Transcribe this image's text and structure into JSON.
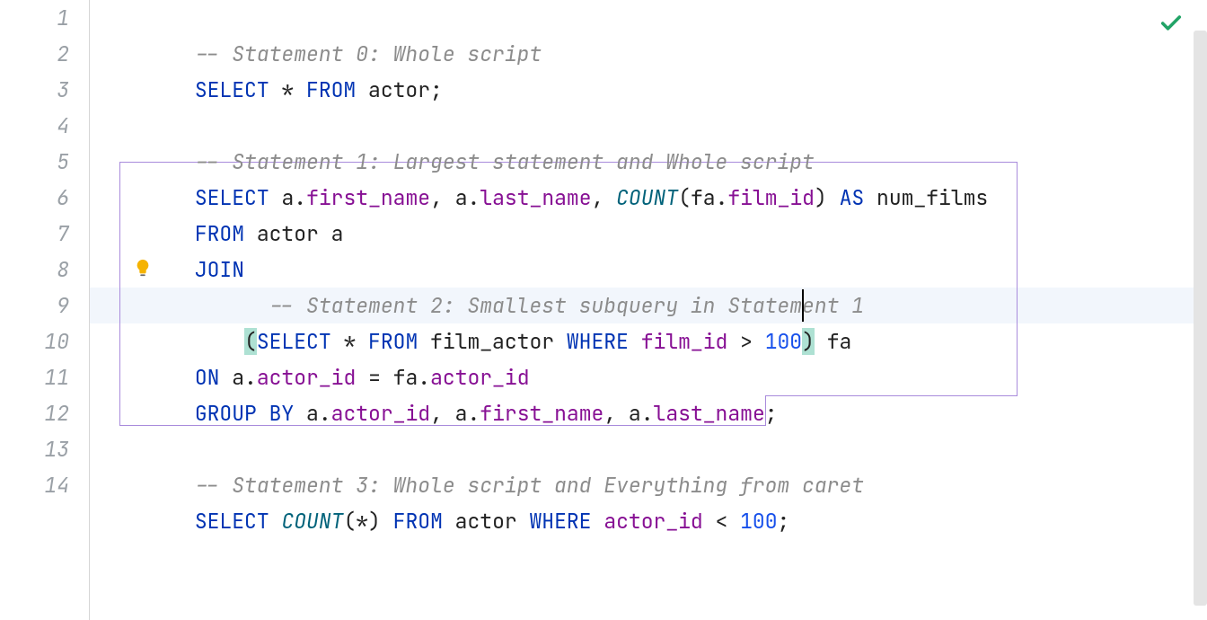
{
  "gutter": {
    "lines": [
      "1",
      "2",
      "3",
      "4",
      "5",
      "6",
      "7",
      "8",
      "9",
      "10",
      "11",
      "12",
      "13",
      "14"
    ]
  },
  "colors": {
    "keyword": "#0033b3",
    "identifier": "#871094",
    "function": "#00627a",
    "number": "#1750eb",
    "comment": "#8c8c8c",
    "text": "#222222",
    "bracket_highlight": "#aee1d3",
    "selection_border": "#a98cdc",
    "current_line_bg": "#f2f6fc"
  },
  "line1": {
    "comment": "-- Statement 0: Whole script"
  },
  "line2": {
    "select": "SELECT",
    "star": " * ",
    "from": "FROM",
    "actor": " actor",
    "semi": ";"
  },
  "line4": {
    "comment": "-- Statement 1: Largest statement and Whole script"
  },
  "line5": {
    "select": "SELECT",
    "sp1": " ",
    "a1": "a",
    "dot1": ".",
    "first": "first_name",
    "com1": ", ",
    "a2": "a",
    "dot2": ".",
    "last": "last_name",
    "com2": ", ",
    "count": "COUNT",
    "lp": "(",
    "fa": "fa",
    "dot3": ".",
    "film": "film_id",
    "rp": ")",
    "sp2": " ",
    "as": "AS",
    "sp3": " ",
    "num": "num_films"
  },
  "line6": {
    "from": "FROM",
    "rest": " actor a"
  },
  "line7": {
    "join": "JOIN"
  },
  "line8": {
    "indent": "      ",
    "comment": "-- Statement 2: Smallest subquery in Statement 1"
  },
  "line9": {
    "indent": "    ",
    "lp": "(",
    "select": "SELECT",
    "star": " * ",
    "from": "FROM",
    "fa": " film_actor ",
    "where": "WHERE",
    "sp1": " ",
    "film": "film_id",
    "gt": " > ",
    "hundred": "100",
    "rp": ")",
    "alias": " fa"
  },
  "line10": {
    "on": "ON",
    "sp1": " ",
    "a1": "a",
    "dot1": ".",
    "aid1": "actor_id",
    "eq": " = ",
    "fa": "fa",
    "dot2": ".",
    "aid2": "actor_id"
  },
  "line11": {
    "group": "GROUP BY",
    "sp1": " ",
    "a1": "a",
    "dot1": ".",
    "aid": "actor_id",
    "com1": ", ",
    "a2": "a",
    "dot2": ".",
    "first": "first_name",
    "com2": ", ",
    "a3": "a",
    "dot3": ".",
    "last": "last_name",
    "semi": ";"
  },
  "line13": {
    "comment": "-- Statement 3: Whole script and Everything from caret"
  },
  "line14": {
    "select": "SELECT",
    "sp1": " ",
    "count": "COUNT",
    "lp": "(*)",
    "sp2": " ",
    "from": "FROM",
    "actor": " actor ",
    "where": "WHERE",
    "sp3": " ",
    "aid": "actor_id",
    "lt": " < ",
    "hundred": "100",
    "semi": ";"
  },
  "icons": {
    "checkmark": "checkmark-icon",
    "bulb": "lightbulb-icon"
  }
}
